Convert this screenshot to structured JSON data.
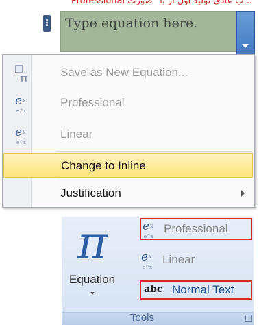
{
  "top_text": "...ب عادی تولید اول از با `صورت Professional",
  "equation_box": {
    "placeholder": "Type equation here."
  },
  "context_menu": {
    "items": [
      {
        "label": "Save as New Equation...",
        "enabled": false,
        "icon": "save-equation-icon"
      },
      {
        "label": "Professional",
        "enabled": false,
        "icon": "professional-icon"
      },
      {
        "label": "Linear",
        "enabled": false,
        "icon": "linear-icon"
      },
      {
        "label": "Change to Inline",
        "enabled": true,
        "highlighted": true
      },
      {
        "label": "Justification",
        "enabled": true,
        "has_submenu": true
      }
    ]
  },
  "ribbon": {
    "equation_label": "Equation",
    "professional_label": "Professional",
    "linear_label": "Linear",
    "normal_text_label": "Normal Text",
    "abc_glyph": "abc",
    "group_label": "Tools"
  },
  "colors": {
    "highlight_outline": "#d9252b",
    "equation_box_bg": "#a4b69a",
    "menu_hover": "#fde47a",
    "pi_blue": "#2e5ea3"
  }
}
